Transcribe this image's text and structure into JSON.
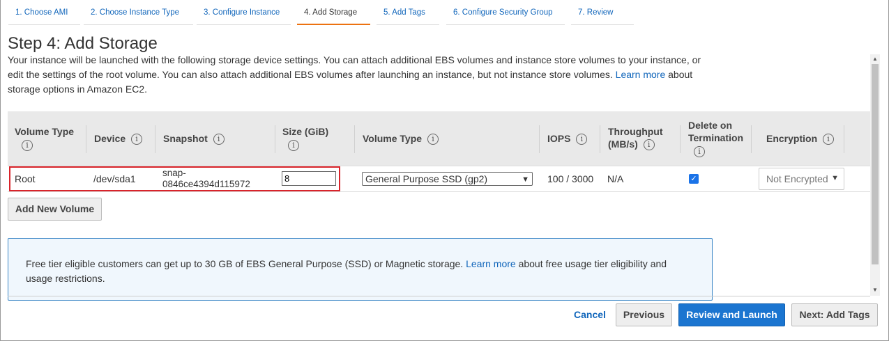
{
  "tabs": [
    {
      "label": "1. Choose AMI"
    },
    {
      "label": "2. Choose Instance Type"
    },
    {
      "label": "3. Configure Instance"
    },
    {
      "label": "4. Add Storage"
    },
    {
      "label": "5. Add Tags"
    },
    {
      "label": "6. Configure Security Group"
    },
    {
      "label": "7. Review"
    }
  ],
  "active_tab": "4. Add Storage",
  "page": {
    "title": "Step 4: Add Storage",
    "intro_text": "Your instance will be launched with the following storage device settings. You can attach additional EBS volumes and instance store volumes to your instance, or edit the settings of the root volume. You can also attach additional EBS volumes after launching an instance, but not instance store volumes.",
    "intro_link": "Learn more",
    "intro_suffix": "about storage options in Amazon EC2."
  },
  "table": {
    "headers": {
      "volume_type": "Volume Type",
      "device": "Device",
      "snapshot": "Snapshot",
      "size": "Size (GiB)",
      "ebs_volume_type": "Volume Type",
      "iops": "IOPS",
      "throughput": "Throughput (MB/s)",
      "delete_on_termination": "Delete on Termination",
      "encryption": "Encryption"
    },
    "info_glyph": "i",
    "rows": [
      {
        "volume_type": "Root",
        "device": "/dev/sda1",
        "snapshot_line1": "snap-",
        "snapshot_line2": "0846ce4394d115972",
        "size": "8",
        "ebs_volume_type": "General Purpose SSD (gp2)",
        "iops": "100 / 3000",
        "throughput": "N/A",
        "delete_on_termination": true,
        "encryption": "Not Encrypted"
      }
    ]
  },
  "add_volume_button": "Add New Volume",
  "notice": {
    "text": "Free tier eligible customers can get up to 30 GB of EBS General Purpose (SSD) or Magnetic storage.",
    "link": "Learn more",
    "suffix": "about free usage tier eligibility and usage restrictions."
  },
  "footer": {
    "cancel": "Cancel",
    "previous": "Previous",
    "review_launch": "Review and Launch",
    "next": "Next: Add Tags"
  },
  "colors": {
    "accent": "#ec7211",
    "link": "#1166bb",
    "primary_button": "#1b75d0",
    "highlight_border": "#d9232a"
  }
}
